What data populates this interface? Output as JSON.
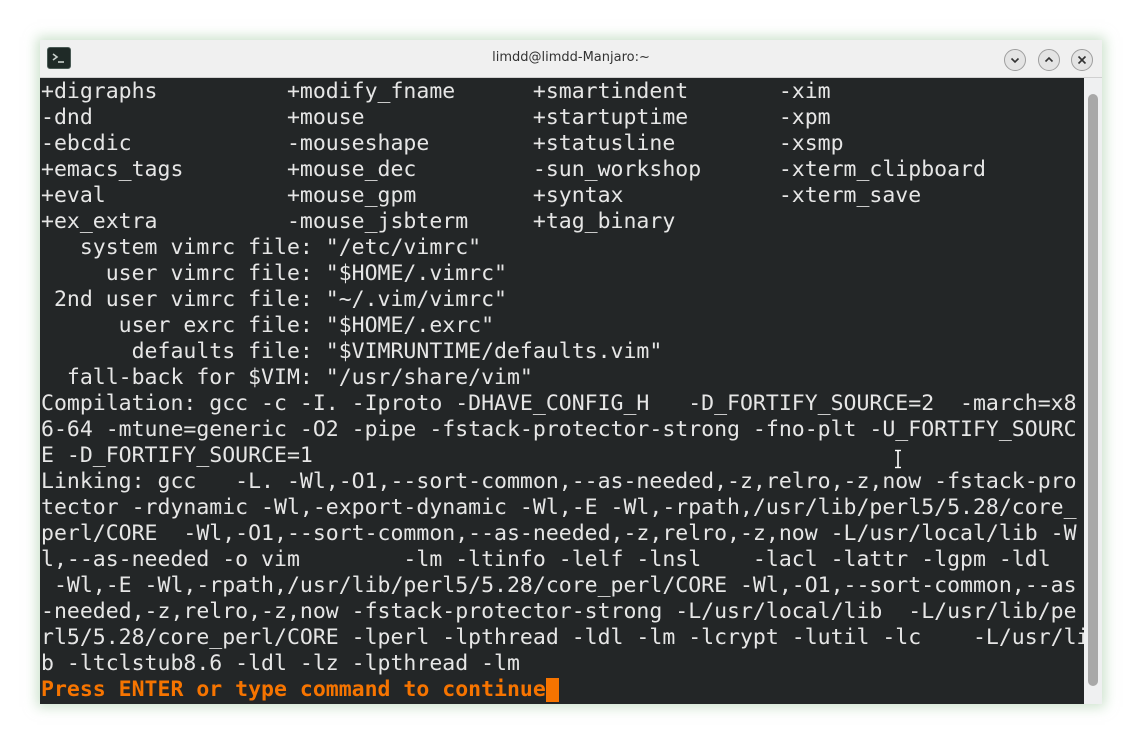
{
  "window": {
    "title": "limdd@limdd-Manjaro:~",
    "icon": "terminal-icon",
    "controls": [
      "minimize-icon",
      "maximize-icon",
      "close-icon"
    ]
  },
  "terminal": {
    "lines": [
      "+digraphs          +modify_fname      +smartindent       -xim",
      "-dnd               +mouse             +startuptime       -xpm",
      "-ebcdic            -mouseshape        +statusline        -xsmp",
      "+emacs_tags        +mouse_dec         -sun_workshop      -xterm_clipboard",
      "+eval              +mouse_gpm         +syntax            -xterm_save",
      "+ex_extra          -mouse_jsbterm     +tag_binary",
      "   system vimrc file: \"/etc/vimrc\"",
      "     user vimrc file: \"$HOME/.vimrc\"",
      " 2nd user vimrc file: \"~/.vim/vimrc\"",
      "      user exrc file: \"$HOME/.exrc\"",
      "       defaults file: \"$VIMRUNTIME/defaults.vim\"",
      "  fall-back for $VIM: \"/usr/share/vim\"",
      "Compilation: gcc -c -I. -Iproto -DHAVE_CONFIG_H   -D_FORTIFY_SOURCE=2  -march=x8",
      "6-64 -mtune=generic -O2 -pipe -fstack-protector-strong -fno-plt -U_FORTIFY_SOURC",
      "E -D_FORTIFY_SOURCE=1",
      "Linking: gcc   -L. -Wl,-O1,--sort-common,--as-needed,-z,relro,-z,now -fstack-pro",
      "tector -rdynamic -Wl,-export-dynamic -Wl,-E -Wl,-rpath,/usr/lib/perl5/5.28/core_",
      "perl/CORE  -Wl,-O1,--sort-common,--as-needed,-z,relro,-z,now -L/usr/local/lib -W",
      "l,--as-needed -o vim        -lm -ltinfo -lelf -lnsl    -lacl -lattr -lgpm -ldl",
      " -Wl,-E -Wl,-rpath,/usr/lib/perl5/5.28/core_perl/CORE -Wl,-O1,--sort-common,--as",
      "-needed,-z,relro,-z,now -fstack-protector-strong -L/usr/local/lib  -L/usr/lib/pe",
      "rl5/5.28/core_perl/CORE -lperl -lpthread -ldl -lm -lcrypt -lutil -lc    -L/usr/li",
      "b -ltclstub8.6 -ldl -lz -lpthread -lm"
    ],
    "prompt": "Press ENTER or type command to continue",
    "colors": {
      "background": "#232627",
      "foreground": "#e6e6e6",
      "prompt": "#f67400"
    }
  }
}
